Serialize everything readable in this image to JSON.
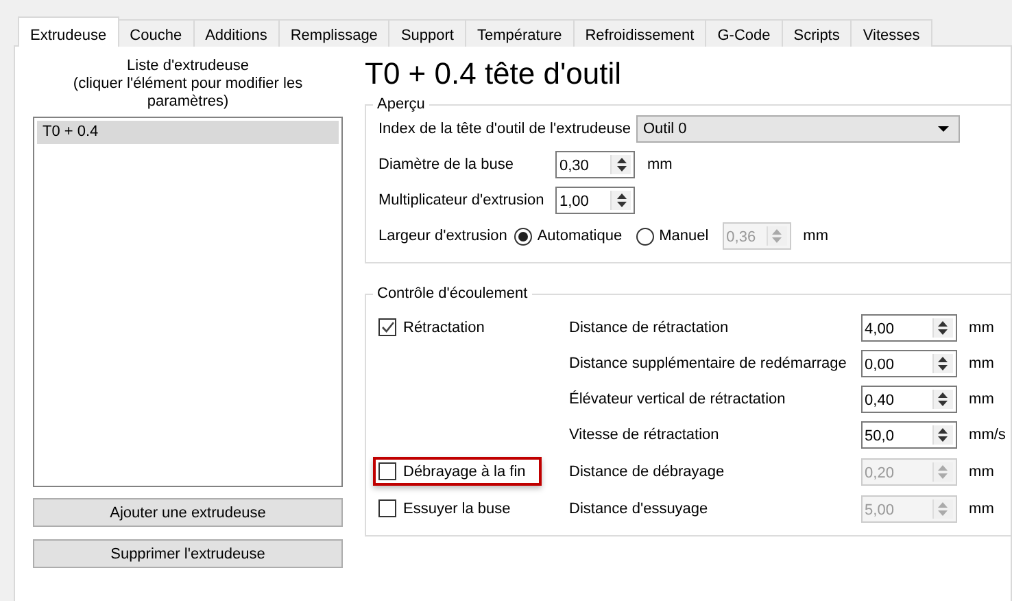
{
  "tabs": [
    {
      "label": "Extrudeuse",
      "selected": true
    },
    {
      "label": "Couche",
      "selected": false
    },
    {
      "label": "Additions",
      "selected": false
    },
    {
      "label": "Remplissage",
      "selected": false
    },
    {
      "label": "Support",
      "selected": false
    },
    {
      "label": "Température",
      "selected": false
    },
    {
      "label": "Refroidissement",
      "selected": false
    },
    {
      "label": "G-Code",
      "selected": false
    },
    {
      "label": "Scripts",
      "selected": false
    },
    {
      "label": "Vitesses",
      "selected": false
    }
  ],
  "extruder_list": {
    "heading": "Liste d'extrudeuse",
    "hint": "(cliquer l'élément pour modifier les paramètres)",
    "items": [
      {
        "label": "T0 + 0.4",
        "selected": true
      }
    ]
  },
  "list_buttons": [
    "Ajouter une extrudeuse",
    "Supprimer l'extrudeuse"
  ],
  "title": "T0 + 0.4 tête d'outil",
  "overview": {
    "legend": "Aperçu",
    "tool_index": {
      "label": "Index de la tête d'outil de l'extrudeuse",
      "value": "Outil 0"
    },
    "nozzle_diameter": {
      "label": "Diamètre de la buse",
      "value": "0,30",
      "unit": "mm"
    },
    "extrusion_multiplier": {
      "label": "Multiplicateur d'extrusion",
      "value": "1,00"
    },
    "extrusion_width": {
      "label": "Largeur d'extrusion",
      "options": [
        {
          "label": "Automatique",
          "selected": true
        },
        {
          "label": "Manuel",
          "selected": false
        }
      ],
      "value": "0,36",
      "disabled": true,
      "unit": "mm"
    }
  },
  "flow_control": {
    "legend": "Contrôle d'écoulement",
    "rows": [
      {
        "checkbox": {
          "label": "Rétractation",
          "checked": true,
          "highlighted": false
        },
        "label": "Distance de rétractation",
        "value": "4,00",
        "unit": "mm",
        "disabled": false
      },
      {
        "label": "Distance supplémentaire de redémarrage",
        "value": "0,00",
        "unit": "mm",
        "disabled": false
      },
      {
        "label": "Élévateur vertical de rétractation",
        "value": "0,40",
        "unit": "mm",
        "disabled": false
      },
      {
        "label": "Vitesse de rétractation",
        "value": "50,0",
        "unit": "mm/s",
        "disabled": false
      },
      {
        "checkbox": {
          "label": "Débrayage à la fin",
          "checked": false,
          "highlighted": true
        },
        "label": "Distance de débrayage",
        "value": "0,20",
        "unit": "mm",
        "disabled": true
      },
      {
        "checkbox": {
          "label": "Essuyer la buse",
          "checked": false,
          "highlighted": false
        },
        "label": "Distance d'essuyage",
        "value": "5,00",
        "unit": "mm",
        "disabled": true
      }
    ]
  }
}
